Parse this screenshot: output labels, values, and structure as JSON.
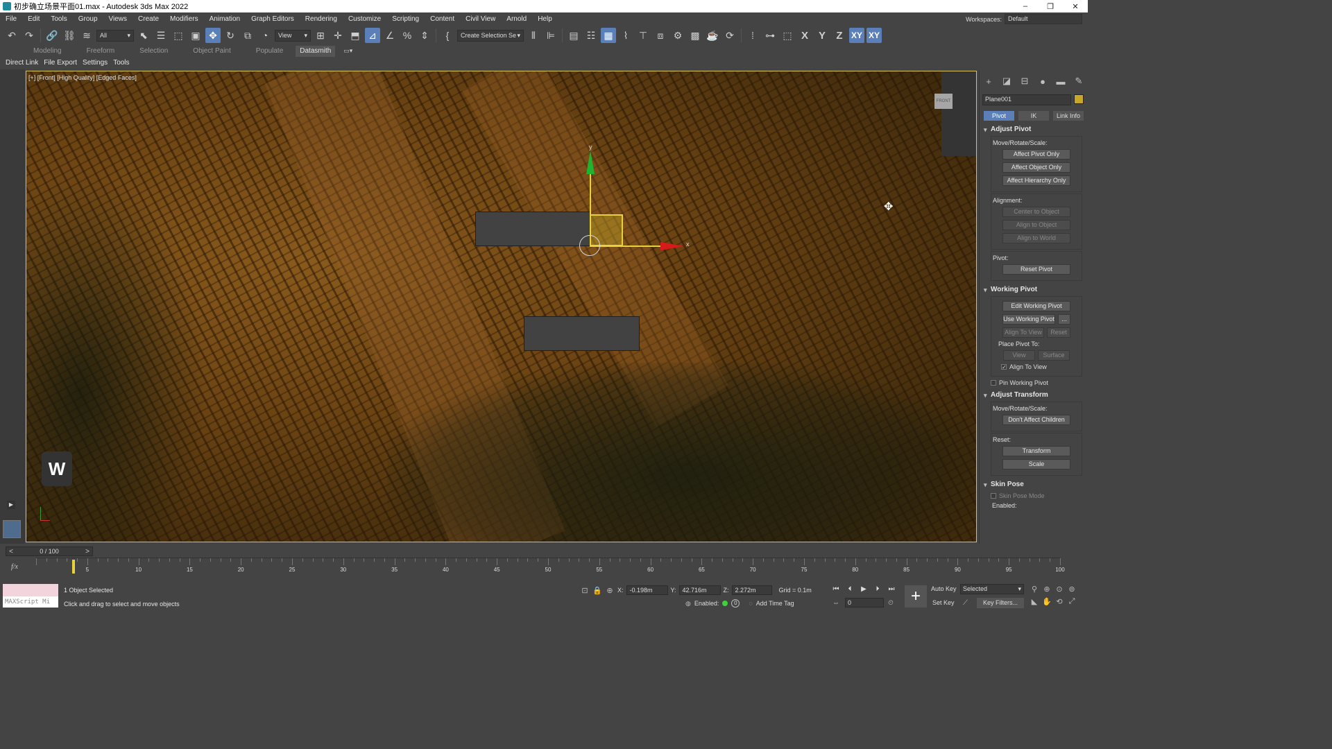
{
  "window": {
    "title": "初步确立场景平面01.max - Autodesk 3ds Max 2022",
    "minimize": "–",
    "restore": "❐",
    "close": "✕"
  },
  "menu": {
    "items": [
      "File",
      "Edit",
      "Tools",
      "Group",
      "Views",
      "Create",
      "Modifiers",
      "Animation",
      "Graph Editors",
      "Rendering",
      "Customize",
      "Scripting",
      "Content",
      "Civil View",
      "Arnold",
      "Help"
    ],
    "workspaces_label": "Workspaces:",
    "workspace_value": "Default"
  },
  "toolbar": {
    "filter_value": "All",
    "view_value": "View",
    "selection_set_value": "Create Selection Se",
    "axis_x": "X",
    "axis_y": "Y",
    "axis_z": "Z",
    "axis_xy": "XY",
    "axis_xy2": "XY"
  },
  "ribbon": {
    "tabs": [
      "Modeling",
      "Freeform",
      "Selection",
      "Object Paint",
      "Populate",
      "Datasmith"
    ],
    "active_tab": "Datasmith"
  },
  "subbar": {
    "items": [
      "Direct Link",
      "File Export",
      "Settings",
      "Tools"
    ]
  },
  "viewport": {
    "label": "[+] [Front] [High Quality] [Edged Faces]",
    "gizmo_y": "y",
    "gizmo_x": "x",
    "w_key": "W",
    "cube_face": "FRONT"
  },
  "command_panel": {
    "object_name": "Plane001",
    "subtabs": [
      "Pivot",
      "IK",
      "Link Info"
    ],
    "active_subtab": "Pivot",
    "adjust_pivot": {
      "title": "Adjust Pivot",
      "move_label": "Move/Rotate/Scale:",
      "affect_pivot": "Affect Pivot Only",
      "affect_object": "Affect Object Only",
      "affect_hierarchy": "Affect Hierarchy Only",
      "alignment_label": "Alignment:",
      "center_to_object": "Center to Object",
      "align_to_object": "Align to Object",
      "align_to_world": "Align to World",
      "pivot_label": "Pivot:",
      "reset_pivot": "Reset Pivot"
    },
    "working_pivot": {
      "title": "Working Pivot",
      "edit": "Edit Working Pivot",
      "use": "Use Working Pivot",
      "use_more": "...",
      "align_to_view_btn": "Align To View",
      "reset": "Reset",
      "place_label": "Place Pivot To:",
      "view": "View",
      "surface": "Surface",
      "align_to_view_check": "Align To View",
      "pin": "Pin Working Pivot"
    },
    "adjust_transform": {
      "title": "Adjust Transform",
      "move_label": "Move/Rotate/Scale:",
      "dont_affect": "Don't Affect Children",
      "reset_label": "Reset:",
      "transform": "Transform",
      "scale": "Scale"
    },
    "skin_pose": {
      "title": "Skin Pose",
      "mode": "Skin Pose Mode",
      "enabled": "Enabled:"
    }
  },
  "timeline": {
    "value": "0 / 100",
    "ticks": [
      5,
      10,
      15,
      20,
      25,
      30,
      35,
      40,
      45,
      50,
      55,
      60,
      65,
      70,
      75,
      80,
      85,
      90,
      95,
      100
    ]
  },
  "status": {
    "maxscript": "MAXScript Mi",
    "selected": "1 Object Selected",
    "prompt": "Click and drag to select and move objects",
    "x_label": "X:",
    "x_value": "-0.198m",
    "y_label": "Y:",
    "y_value": "42.716m",
    "z_label": "Z:",
    "z_value": "2.272m",
    "grid": "Grid = 0.1m",
    "enabled_label": "Enabled:",
    "enabled_value": "0",
    "add_time_tag": "Add Time Tag",
    "frame_value": "0",
    "auto_key": "Auto Key",
    "set_key": "Set Key",
    "selected_value": "Selected",
    "key_filters": "Key Filters..."
  }
}
